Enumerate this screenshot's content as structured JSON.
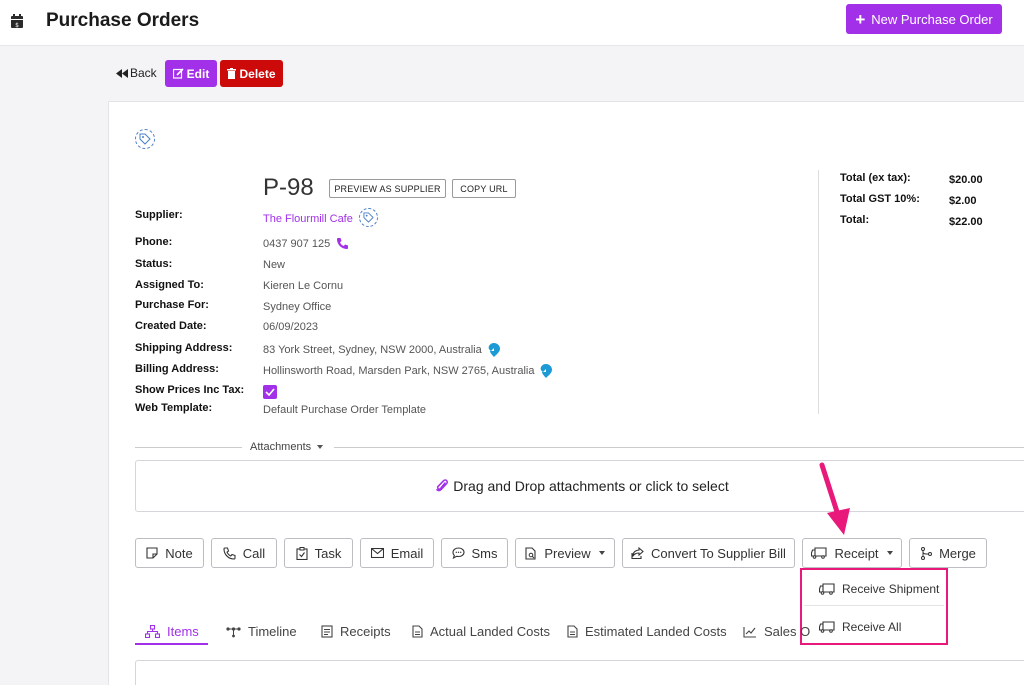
{
  "header": {
    "title": "Purchase Orders",
    "new_button": "New Purchase Order"
  },
  "toolbar": {
    "back": "Back",
    "edit": "Edit",
    "delete": "Delete"
  },
  "po": {
    "number": "P-98",
    "preview_as_supplier": "PREVIEW AS SUPPLIER",
    "copy_url": "COPY URL"
  },
  "fields": {
    "supplier_label": "Supplier:",
    "supplier_value": "The Flourmill Cafe",
    "phone_label": "Phone:",
    "phone_value": "0437 907 125",
    "status_label": "Status:",
    "status_value": "New",
    "assigned_label": "Assigned To:",
    "assigned_value": "Kieren Le Cornu",
    "purchase_for_label": "Purchase For:",
    "purchase_for_value": "Sydney Office",
    "created_label": "Created Date:",
    "created_value": "06/09/2023",
    "shipping_label": "Shipping Address:",
    "shipping_value": "83 York Street, Sydney, NSW 2000, Australia",
    "billing_label": "Billing Address:",
    "billing_value": "Hollinsworth Road, Marsden Park, NSW 2765, Australia",
    "show_prices_label": "Show Prices Inc Tax:",
    "show_prices_checked": true,
    "web_template_label": "Web Template:",
    "web_template_value": "Default Purchase Order Template"
  },
  "totals": {
    "ex_tax_label": "Total (ex tax):",
    "ex_tax_value": "$20.00",
    "gst_label": "Total GST 10%:",
    "gst_value": "$2.00",
    "total_label": "Total:",
    "total_value": "$22.00"
  },
  "attachments": {
    "label": "Attachments",
    "dropzone_text": "Drag and Drop attachments or click to select"
  },
  "actions": {
    "note": "Note",
    "call": "Call",
    "task": "Task",
    "email": "Email",
    "sms": "Sms",
    "preview": "Preview",
    "convert": "Convert To Supplier Bill",
    "receipt": "Receipt",
    "merge": "Merge"
  },
  "receipt_menu": {
    "receive_shipment": "Receive Shipment",
    "receive_all": "Receive All"
  },
  "tabs": {
    "items": "Items",
    "timeline": "Timeline",
    "receipts": "Receipts",
    "actual_landed": "Actual Landed Costs",
    "estimated_landed": "Estimated Landed Costs",
    "sales": "Sales O"
  },
  "colors": {
    "accent": "#a230e8",
    "danger": "#cc0a0a",
    "highlight": "#e8197a",
    "pin": "#1b9ad6"
  }
}
